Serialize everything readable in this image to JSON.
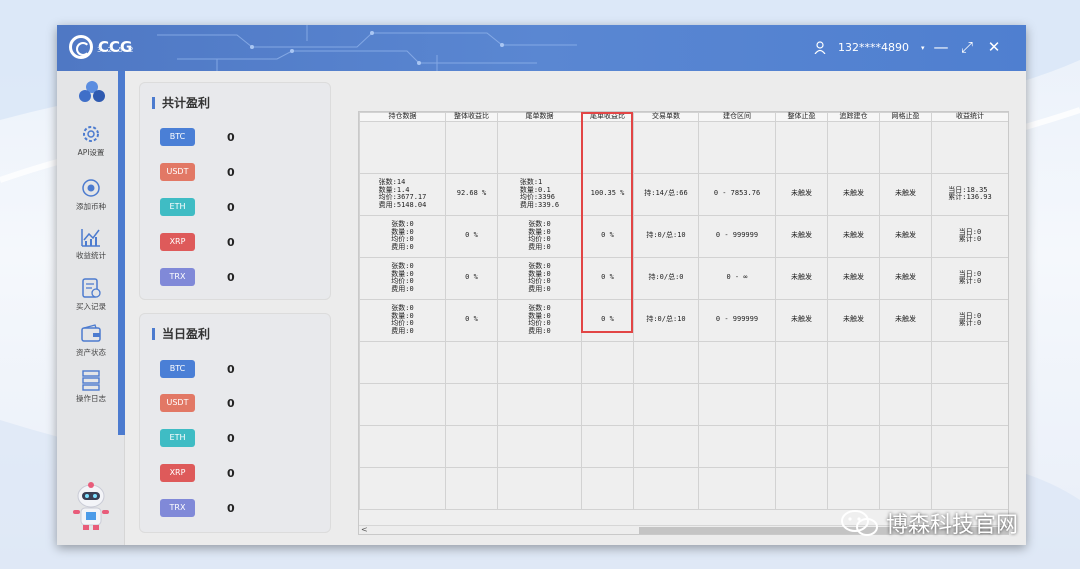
{
  "app": {
    "name": "CCG",
    "version": "3.2.5.2"
  },
  "user": {
    "phone": "132****4890",
    "dropdown": "▾"
  },
  "window_controls": {
    "minimize": "—",
    "maximize": "⤢",
    "close": "✕"
  },
  "nav": [
    {
      "label": "API设置",
      "icon": "gear-icon"
    },
    {
      "label": "添加币种",
      "icon": "add-coin-icon"
    },
    {
      "label": "收益统计",
      "icon": "chart-icon"
    },
    {
      "label": "买入记录",
      "icon": "record-icon"
    },
    {
      "label": "资产状态",
      "icon": "wallet-icon"
    },
    {
      "label": "操作日志",
      "icon": "log-icon"
    }
  ],
  "total_profit": {
    "title": "共计盈利",
    "coins": [
      {
        "name": "BTC",
        "value": "0",
        "color": "#4a7fd6"
      },
      {
        "name": "USDT",
        "value": "0",
        "color": "#e27865"
      },
      {
        "name": "ETH",
        "value": "0",
        "color": "#3fbcc4"
      },
      {
        "name": "XRP",
        "value": "0",
        "color": "#de5a5a"
      },
      {
        "name": "TRX",
        "value": "0",
        "color": "#8089d8"
      }
    ]
  },
  "daily_profit": {
    "title": "当日盈利",
    "coins": [
      {
        "name": "BTC",
        "value": "0",
        "color": "#4a7fd6"
      },
      {
        "name": "USDT",
        "value": "0",
        "color": "#e27865"
      },
      {
        "name": "ETH",
        "value": "0",
        "color": "#3fbcc4"
      },
      {
        "name": "XRP",
        "value": "0",
        "color": "#de5a5a"
      },
      {
        "name": "TRX",
        "value": "0",
        "color": "#8089d8"
      }
    ]
  },
  "table": {
    "headers": [
      "持仓数据",
      "整体收益比",
      "尾单数据",
      "尾单收益比",
      "交易单数",
      "建仓区间",
      "整体止盈",
      "追踪建仓",
      "网格止盈",
      "收益统计"
    ],
    "rows": [
      [
        "",
        "",
        "",
        "",
        "",
        "",
        "",
        "",
        "",
        ""
      ],
      [
        "张数:14\n数量:1.4\n均价:3677.17\n费用:5148.04",
        "92.68 %",
        "张数:1\n数量:0.1\n均价:3396\n费用:339.6",
        "100.35 %",
        "持:14/总:66",
        "0 - 7853.76",
        "未触发",
        "未触发",
        "未触发",
        "当日:18.35\n累计:136.93"
      ],
      [
        "张数:0\n数量:0\n均价:0\n费用:0",
        "0 %",
        "张数:0\n数量:0\n均价:0\n费用:0",
        "0 %",
        "持:0/总:10",
        "0 - 999999",
        "未触发",
        "未触发",
        "未触发",
        "当日:0\n累计:0"
      ],
      [
        "张数:0\n数量:0\n均价:0\n费用:0",
        "0 %",
        "张数:0\n数量:0\n均价:0\n费用:0",
        "0 %",
        "持:0/总:0",
        "0 - ∞",
        "未触发",
        "未触发",
        "未触发",
        "当日:0\n累计:0"
      ],
      [
        "张数:0\n数量:0\n均价:0\n费用:0",
        "0 %",
        "张数:0\n数量:0\n均价:0\n费用:0",
        "0 %",
        "持:0/总:10",
        "0 - 999999",
        "未触发",
        "未触发",
        "未触发",
        "当日:0\n累计:0"
      ],
      [
        "",
        "",
        "",
        "",
        "",
        "",
        "",
        "",
        "",
        ""
      ],
      [
        "",
        "",
        "",
        "",
        "",
        "",
        "",
        "",
        "",
        ""
      ],
      [
        "",
        "",
        "",
        "",
        "",
        "",
        "",
        "",
        "",
        ""
      ],
      [
        "",
        "",
        "",
        "",
        "",
        "",
        "",
        "",
        "",
        ""
      ]
    ],
    "scroll_left": "<"
  },
  "watermark": "博森科技官网"
}
